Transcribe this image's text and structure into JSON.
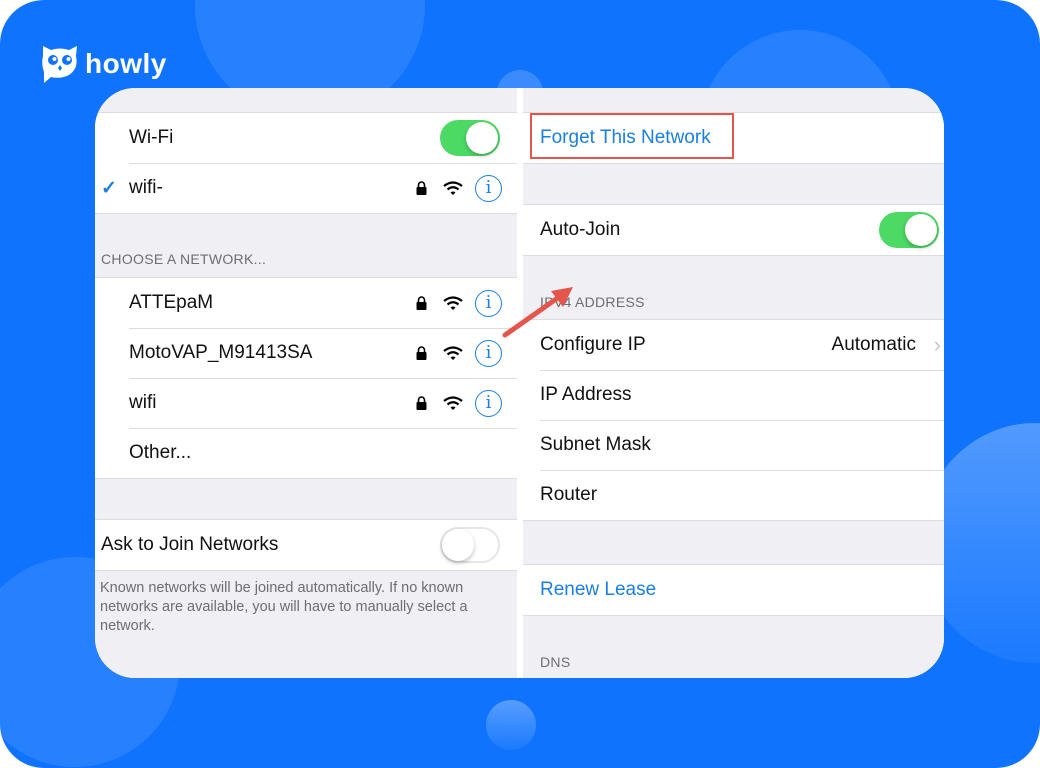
{
  "brand": {
    "name": "howly",
    "icon": "owl-icon"
  },
  "colors": {
    "background": "#0f73fe",
    "accent": "#1a7fe0",
    "switch_on": "#4cd964",
    "annotation": "#e5554b"
  },
  "left_pane": {
    "wifi_toggle": {
      "label": "Wi-Fi",
      "state": "on"
    },
    "connected_network": {
      "name": "wifi-",
      "selected": true,
      "icons": [
        "checkmark-icon",
        "lock-icon",
        "wifi-signal-icon",
        "info-icon"
      ]
    },
    "choose_header": "CHOOSE A NETWORK...",
    "networks": [
      {
        "name": "ATTEpaM",
        "secured": true
      },
      {
        "name": "MotoVAP_M91413SA",
        "secured": true
      },
      {
        "name": "wifi",
        "secured": true
      }
    ],
    "other_label": "Other...",
    "ask_to_join": {
      "label": "Ask to Join Networks",
      "state": "off"
    },
    "footnote": "Known networks will be joined automatically. If no known networks are available, you will have to manually select a network."
  },
  "right_pane": {
    "forget_label": "Forget This Network",
    "auto_join": {
      "label": "Auto-Join",
      "state": "on"
    },
    "ipv4_header": "IPV4 ADDRESS",
    "ipv4_rows": [
      {
        "label": "Configure IP",
        "value": "Automatic",
        "chevron": true
      },
      {
        "label": "IP Address",
        "value": ""
      },
      {
        "label": "Subnet Mask",
        "value": ""
      },
      {
        "label": "Router",
        "value": ""
      }
    ],
    "renew_label": "Renew Lease",
    "dns_header": "DNS"
  },
  "symbols": {
    "check": "✓",
    "info": "i",
    "chevron": "›"
  }
}
